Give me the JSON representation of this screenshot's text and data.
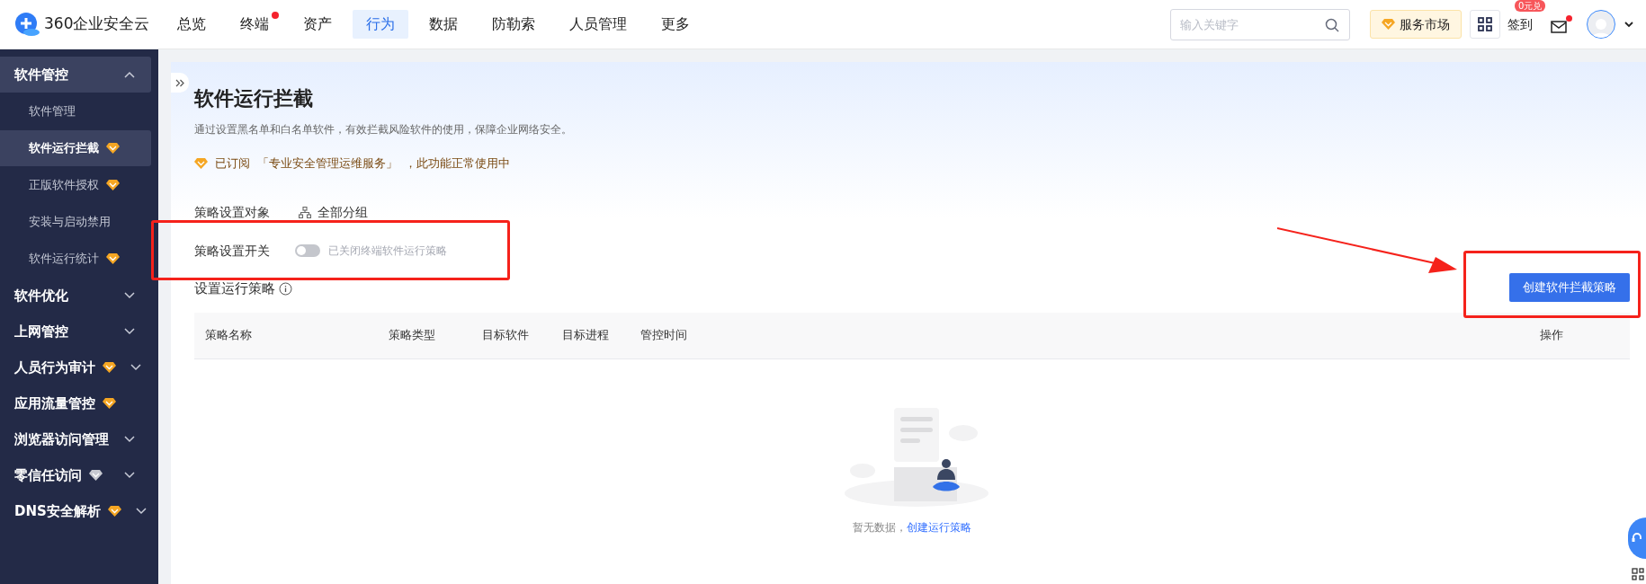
{
  "header": {
    "logo_text": "360企业安全云",
    "nav": [
      {
        "label": "总览",
        "selected": false,
        "dot": false
      },
      {
        "label": "终端",
        "selected": false,
        "dot": true
      },
      {
        "label": "资产",
        "selected": false,
        "dot": false
      },
      {
        "label": "行为",
        "selected": true,
        "dot": false
      },
      {
        "label": "数据",
        "selected": false,
        "dot": false
      },
      {
        "label": "防勒索",
        "selected": false,
        "dot": false
      },
      {
        "label": "人员管理",
        "selected": false,
        "dot": false
      },
      {
        "label": "更多",
        "selected": false,
        "dot": false
      }
    ],
    "search": {
      "placeholder": "输入关键字"
    },
    "market": "服务市场",
    "checkin": "签到",
    "checkin_badge": "0元兑",
    "mail_dot": true
  },
  "sidebar": [
    {
      "label": "软件管控",
      "expandable": true,
      "expanded": true,
      "selected": true,
      "children": [
        {
          "label": "软件管理",
          "selected": false
        },
        {
          "label": "软件运行拦截",
          "selected": true,
          "color": "#f5a623"
        },
        {
          "label": "正版软件授权",
          "selected": false,
          "color": "#f5a623"
        },
        {
          "label": "安装与启动禁用",
          "selected": false
        },
        {
          "label": "软件运行统计",
          "selected": false,
          "color": "#f5a623"
        }
      ]
    },
    {
      "label": "软件优化",
      "expandable": true,
      "expanded": false,
      "selected": false
    },
    {
      "label": "上网管控",
      "expandable": true,
      "expanded": false,
      "selected": false
    },
    {
      "label": "人员行为审计",
      "expandable": true,
      "expanded": false,
      "selected": false,
      "color": "#f5a623"
    },
    {
      "label": "应用流量管控",
      "expandable": false,
      "selected": false,
      "color": "#f5a623"
    },
    {
      "label": "浏览器访问管理",
      "expandable": true,
      "expanded": false,
      "selected": false
    },
    {
      "label": "零信任访问",
      "expandable": true,
      "expanded": false,
      "selected": false,
      "color": "#c7c9d1"
    },
    {
      "label": "DNS安全解析",
      "expandable": true,
      "expanded": false,
      "selected": false,
      "color": "#f5a623"
    }
  ],
  "page": {
    "title": "软件运行拦截",
    "description": "通过设置黑名单和白名单软件，有效拦截风险软件的使用，保障企业网络安全。",
    "subscription": [
      "已订阅",
      "「专业安全管理运维服务」",
      "，此功能正常使用中"
    ],
    "target_label": "策略设置对象",
    "target_value": "全部分组",
    "switch_label": "策略设置开关",
    "switch": {
      "on": false,
      "text": "已关闭终端软件运行策略"
    },
    "section_title": "设置运行策略",
    "create_button": "创建软件拦截策略",
    "table": {
      "columns": [
        "策略名称",
        "策略类型",
        "目标软件",
        "目标进程",
        "管控时间",
        "操作"
      ]
    },
    "empty": {
      "text": "暂无数据，",
      "link": "创建运行策略"
    }
  }
}
